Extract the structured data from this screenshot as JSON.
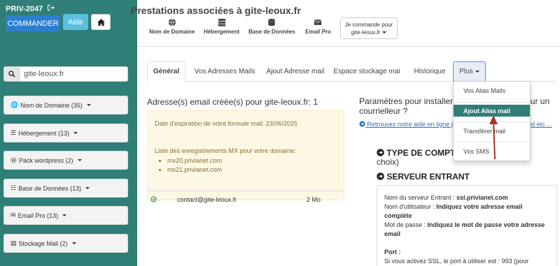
{
  "account": {
    "id": "PRIV-2047",
    "logout_icon": "logout-icon"
  },
  "buttons": {
    "commander": "COMMANDER",
    "aide": "Aide",
    "home_icon": "home-icon"
  },
  "search": {
    "value": "gite-leoux.fr",
    "icon": "search-icon"
  },
  "sidebar": {
    "items": [
      {
        "label": "Nom de Domaine (35)",
        "icon": "globe-icon"
      },
      {
        "label": "Hébergement (13)",
        "icon": "server-icon"
      },
      {
        "label": "Pack wordpress (2)",
        "icon": "wordpress-icon"
      },
      {
        "label": "Base de Données (13)",
        "icon": "database-icon"
      },
      {
        "label": "Email Pro (13)",
        "icon": "envelope-icon"
      },
      {
        "label": "Stockage Mail (2)",
        "icon": "inbox-icon"
      }
    ]
  },
  "header": {
    "title": "Prestations associées à gite-leoux.fr",
    "services": [
      {
        "label": "Nom de Domaine",
        "icon": "globe-icon"
      },
      {
        "label": "Hébergement",
        "icon": "server-icon"
      },
      {
        "label": "Base de Données",
        "icon": "database-icon"
      },
      {
        "label": "Email Pro",
        "icon": "envelope-icon"
      }
    ],
    "je_commande_line1": "Je commande pour",
    "je_commande_line2": "gite-leoux.fr"
  },
  "tabs": [
    {
      "label": "Général",
      "active": true
    },
    {
      "label": "Vos Adresses Mails"
    },
    {
      "label": "Ajout Adresse mail"
    },
    {
      "label": "Espace stockage mai"
    },
    {
      "label": "Historique"
    },
    {
      "label": "Plus"
    }
  ],
  "main": {
    "heading": "Adresse(s) email créée(s) pour gite-leoux.fr: 1",
    "expiration": "Date d'expiration de votre formule mail: 23/06/2025",
    "mx_heading": "Liste des enregistrements MX pour votre domaine:",
    "mx": [
      "mx20.privianet.com",
      "mx21.privianet.com"
    ],
    "emails": [
      {
        "address": "contact@gite-leoux.fr",
        "size": "2 Mo",
        "status_icon": "check-circle-icon"
      }
    ]
  },
  "right": {
    "heading": "Paramètres pour installer votre adresse mail sur un courrielleur ?",
    "link": "Retrouvez notre aide en ligne pour Outlook, iPhone, android etc ...",
    "type_heading": "TYPE DE COMPTE",
    "type_choice": "choix)",
    "server_heading": "SERVEUR ENTRANT",
    "server_label": "Nom du serveur Entrant : ",
    "server_value": "ssl.privianet.com",
    "user_label": "Nom d'utilisateur : ",
    "user_value": "Indiquez votre adresse email complète",
    "pass_label": "Mot de passe : ",
    "pass_value": "Indiquez le mot de passe votre adresse email",
    "port_label": "Port :",
    "port_line": "Si vous activez SSL, le port à utiliser est : 993 (pour"
  },
  "dropdown": {
    "items": [
      {
        "label": "Vos Alias Mails"
      },
      {
        "label": "Ajout Alias mail",
        "active": true
      },
      {
        "label": "Transférer mail"
      },
      {
        "label": "Vos SMS"
      }
    ]
  },
  "colors": {
    "teal": "#2f7f78",
    "primary": "#2c7fcf",
    "info": "#5bc0de",
    "annotation_arrow": "#a8322f"
  }
}
